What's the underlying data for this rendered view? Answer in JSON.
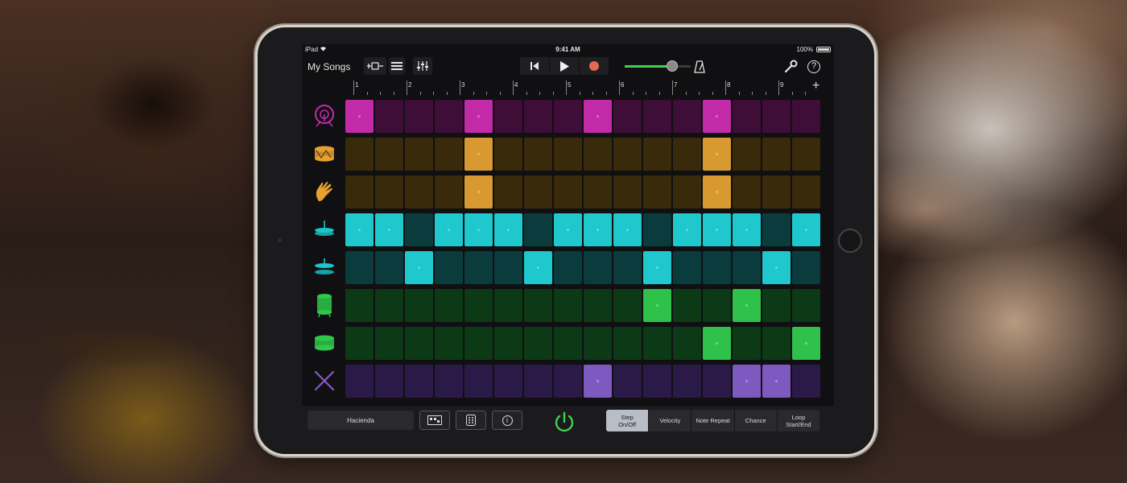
{
  "status_bar": {
    "device": "iPad",
    "time": "9:41 AM",
    "battery": "100%"
  },
  "toolbar": {
    "my_songs": "My Songs",
    "help_label": "?",
    "volume_level": 0.72
  },
  "ruler": {
    "bars": [
      "1",
      "2",
      "3",
      "4",
      "5",
      "6",
      "7",
      "8",
      "9"
    ],
    "add_label": "+"
  },
  "instruments": [
    {
      "name": "kick-drum-icon",
      "color": "#c82ab0"
    },
    {
      "name": "snare-drum-icon",
      "color": "#e8a030"
    },
    {
      "name": "hand-clap-icon",
      "color": "#e8a030"
    },
    {
      "name": "closed-hihat-icon",
      "color": "#18c8cc"
    },
    {
      "name": "open-hihat-icon",
      "color": "#18c8cc"
    },
    {
      "name": "floor-tom-icon",
      "color": "#2ec84a"
    },
    {
      "name": "tom-drum-icon",
      "color": "#2ec84a"
    },
    {
      "name": "sticks-icon",
      "color": "#8858c8"
    }
  ],
  "rows": [
    {
      "on_color": "#c22aa8",
      "off_color": "#3e0d38",
      "steps": [
        1,
        0,
        0,
        0,
        1,
        0,
        0,
        0,
        1,
        0,
        0,
        0,
        1,
        0,
        0,
        0
      ]
    },
    {
      "on_color": "#d89a30",
      "off_color": "#3a2a0c",
      "steps": [
        0,
        0,
        0,
        0,
        1,
        0,
        0,
        0,
        0,
        0,
        0,
        0,
        1,
        0,
        0,
        0
      ]
    },
    {
      "on_color": "#d89a30",
      "off_color": "#3a2a0c",
      "steps": [
        0,
        0,
        0,
        0,
        1,
        0,
        0,
        0,
        0,
        0,
        0,
        0,
        1,
        0,
        0,
        0
      ]
    },
    {
      "on_color": "#1ec8cc",
      "off_color": "#0a3b3d",
      "steps": [
        1,
        1,
        0,
        1,
        1,
        1,
        0,
        1,
        1,
        1,
        0,
        1,
        1,
        1,
        0,
        1
      ]
    },
    {
      "on_color": "#1ec8cc",
      "off_color": "#0a3b3d",
      "steps": [
        0,
        0,
        1,
        0,
        0,
        0,
        1,
        0,
        0,
        0,
        1,
        0,
        0,
        0,
        1,
        0
      ]
    },
    {
      "on_color": "#2ec24a",
      "off_color": "#0d3a16",
      "steps": [
        0,
        0,
        0,
        0,
        0,
        0,
        0,
        0,
        0,
        0,
        1,
        0,
        0,
        1,
        0,
        0
      ]
    },
    {
      "on_color": "#2ec24a",
      "off_color": "#0d3a16",
      "steps": [
        0,
        0,
        0,
        0,
        0,
        0,
        0,
        0,
        0,
        0,
        0,
        0,
        1,
        0,
        0,
        1
      ]
    },
    {
      "on_color": "#7e5ac0",
      "off_color": "#2b1a48",
      "steps": [
        0,
        0,
        0,
        0,
        0,
        0,
        0,
        0,
        1,
        0,
        0,
        0,
        0,
        1,
        1,
        0
      ]
    }
  ],
  "bottom_bar": {
    "kit_name": "Hacienda",
    "info_label": "i",
    "modes": [
      {
        "line1": "Step",
        "line2": "On/Off",
        "active": true
      },
      {
        "line1": "Velocity",
        "line2": "",
        "active": false
      },
      {
        "line1": "Note Repeat",
        "line2": "",
        "active": false
      },
      {
        "line1": "Chance",
        "line2": "",
        "active": false
      },
      {
        "line1": "Loop",
        "line2": "Start/End",
        "active": false
      }
    ]
  },
  "colors": {
    "accent_green": "#3ed14e",
    "record": "#e06a52"
  }
}
